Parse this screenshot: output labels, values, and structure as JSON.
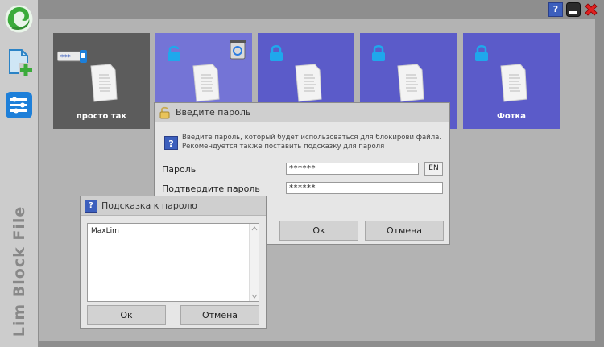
{
  "app": {
    "title": "Lim Block File"
  },
  "sidebar": {
    "buttons": [
      {
        "icon": "logo-icon"
      },
      {
        "icon": "add-file-icon"
      },
      {
        "icon": "settings-sliders-icon"
      }
    ]
  },
  "window_controls": {
    "help": "?",
    "minimize_icon": "minimize-icon",
    "close_icon": "close-icon"
  },
  "tiles": [
    {
      "label": "просто так",
      "locked": false,
      "color": "#5c5c5c",
      "key_badge": "***"
    },
    {
      "label": "",
      "locked": true,
      "color": "#7474d6"
    },
    {
      "label": "",
      "locked": true,
      "color": "#5b5bc9"
    },
    {
      "label": "",
      "locked": true,
      "color": "#5b5bc9"
    },
    {
      "label": "Фотка",
      "locked": true,
      "color": "#5b5bc9"
    }
  ],
  "password_dialog": {
    "title": "Введите пароль",
    "info_line1": "Введите пароль, который будет использоваться для блокирови файла.",
    "info_line2": "Рекомендуется также поставить подсказку для пароля",
    "password_label": "Пароль",
    "password_value": "******",
    "lang_button": "EN",
    "confirm_label": "Подтвердите пароль",
    "confirm_value": "******",
    "ok_label": "Ок",
    "cancel_label": "Отмена"
  },
  "hint_dialog": {
    "title": "Подсказка к паролю",
    "hint_text": "MaxLim",
    "ok_label": "Ок",
    "cancel_label": "Отмена"
  },
  "colors": {
    "accent_blue": "#3c5fbd",
    "lock_cyan": "#1fa8ec",
    "close_red": "#e02020",
    "logo_green": "#3bab3b"
  }
}
